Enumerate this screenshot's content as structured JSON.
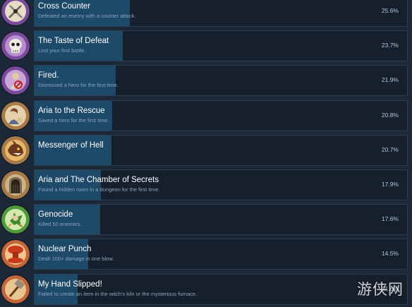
{
  "achievements": [
    {
      "title": "Cross Counter",
      "description": "Defeated an enemy with a counter attack.",
      "percent": "25.6%",
      "percent_value": 25.6,
      "icon": "crossed-swords-icon",
      "icon_bg": "#7b4a9c"
    },
    {
      "title": "The Taste of Defeat",
      "description": "Lost your first battle.",
      "percent": "23.7%",
      "percent_value": 23.7,
      "icon": "skull-icon",
      "icon_bg": "#7b4a9c"
    },
    {
      "title": "Fired.",
      "description": "Dismissed a hero for the first time.",
      "percent": "21.9%",
      "percent_value": 21.9,
      "icon": "dismissed-hero-icon",
      "icon_bg": "#7b4a9c"
    },
    {
      "title": "Aria to the Rescue",
      "description": "Saved a hero for the first time.",
      "percent": "20.8%",
      "percent_value": 20.8,
      "icon": "rescue-hero-icon",
      "icon_bg": "#a77a48"
    },
    {
      "title": "Messenger of Hell",
      "description": "",
      "percent": "20.7%",
      "percent_value": 20.7,
      "icon": "demon-icon",
      "icon_bg": "#a77a48"
    },
    {
      "title": "Aria and The Chamber of Secrets",
      "description": "Found a hidden room in a dungeon for the first time.",
      "percent": "17.9%",
      "percent_value": 17.9,
      "icon": "dungeon-door-icon",
      "icon_bg": "#a77a48"
    },
    {
      "title": "Genocide",
      "description": "Killed 50 enemies.",
      "percent": "17.6%",
      "percent_value": 17.6,
      "icon": "goblin-icon",
      "icon_bg": "#4f9a3c"
    },
    {
      "title": "Nuclear Punch",
      "description": "Dealt 100+ damage in one blow.",
      "percent": "14.5%",
      "percent_value": 14.5,
      "icon": "mushroom-cloud-icon",
      "icon_bg": "#c4663a"
    },
    {
      "title": "My Hand Slipped!",
      "description": "Failed to create an item in the witch's kiln or the mysterious furnace.",
      "percent": "11.6%",
      "percent_value": 11.6,
      "icon": "hammer-icon",
      "icon_bg": "#c4663a"
    }
  ],
  "watermark": "游侠网",
  "colors": {
    "background": "#1b2838",
    "panel": "#16202d",
    "progress": "#1e4a6a",
    "percent_text": "#acc6de"
  }
}
